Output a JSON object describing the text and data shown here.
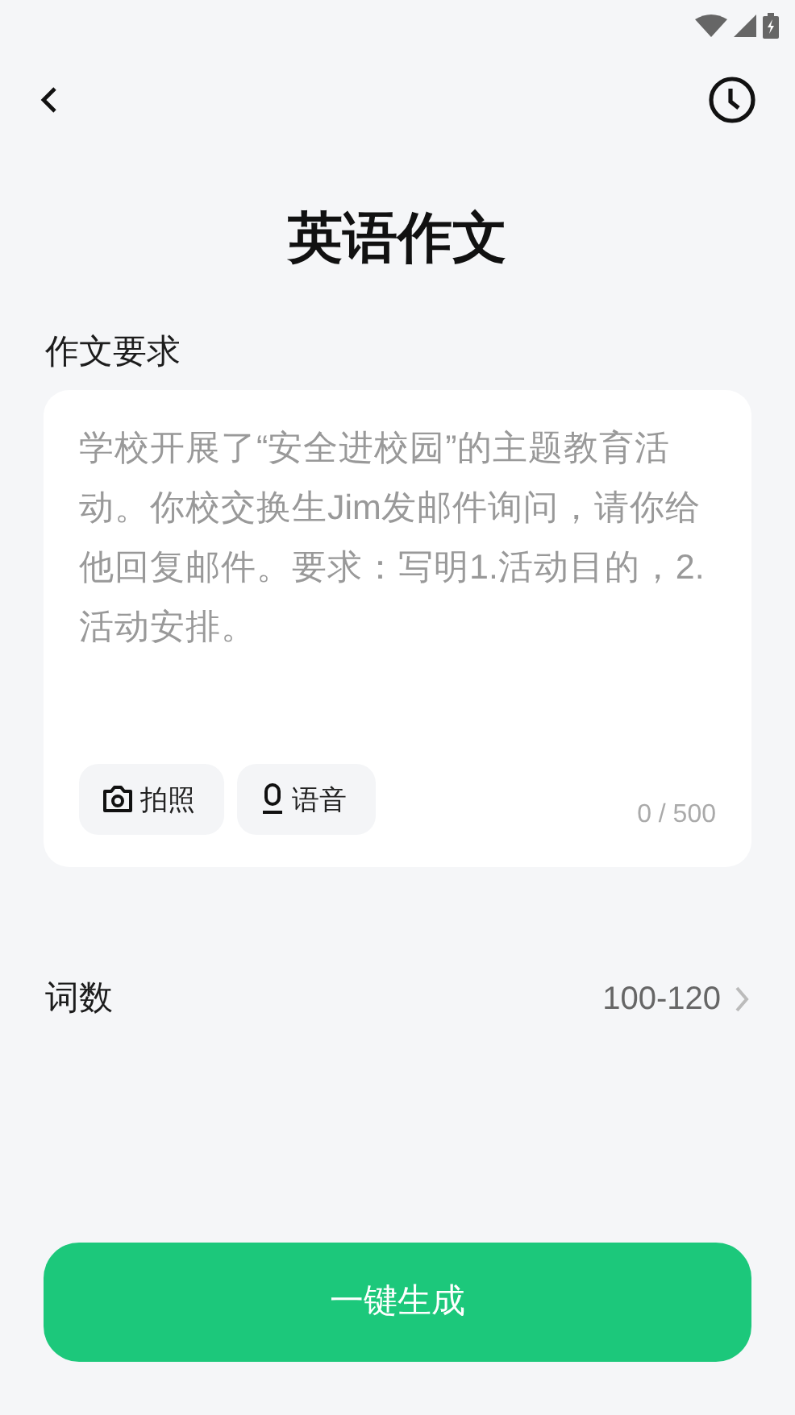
{
  "header": {
    "title": "英语作文"
  },
  "requirement": {
    "label": "作文要求",
    "placeholder": "学校开展了“安全进校园”的主题教育活动。你校交换生Jim发邮件询问，请你给他回复邮件。要求：写明1.活动目的，2.活动安排。",
    "counter": "0 / 500",
    "tools": [
      {
        "kind": "camera",
        "label": "拍照"
      },
      {
        "kind": "mic",
        "label": "语音"
      }
    ]
  },
  "word_count": {
    "label": "词数",
    "value": "100-120"
  },
  "generate_button": "一键生成"
}
